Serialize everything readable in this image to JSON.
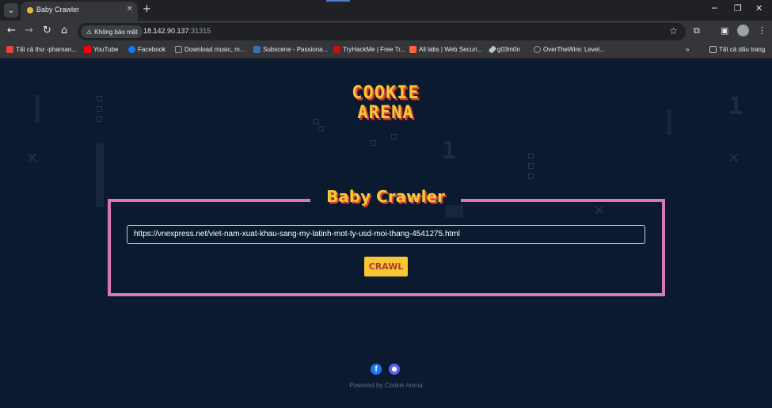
{
  "browser": {
    "tab_title": "Baby Crawler",
    "tab_favicon": "cookie-icon",
    "new_tab": "+",
    "security_chip": "Không bảo mật",
    "url_host": "18.142.90.137",
    "url_port": ":31315",
    "window_controls": {
      "minimize": "─",
      "maximize": "❐",
      "close": "✕"
    },
    "bookmarks": [
      {
        "label": "Tất cả thư -phaman...",
        "icon": "gmail-icon",
        "color": "#ea4335"
      },
      {
        "label": "YouTube",
        "icon": "youtube-icon",
        "color": "#ff0000"
      },
      {
        "label": "Facebook",
        "icon": "facebook-icon",
        "color": "#1877f2"
      },
      {
        "label": "Download music, m...",
        "icon": "download-icon",
        "color": "#9aa0a6"
      },
      {
        "label": "Subscene - Passiona...",
        "icon": "subscene-icon",
        "color": "#3d6db5"
      },
      {
        "label": "TryHackMe | Free Tr...",
        "icon": "tryhackme-icon",
        "color": "#c11111"
      },
      {
        "label": "All labs | Web Securi...",
        "icon": "portswigger-icon",
        "color": "#ff6633"
      },
      {
        "label": "g03m0n",
        "icon": "pen-icon",
        "color": "#bdc1c6"
      },
      {
        "label": "OverTheWire: Level...",
        "icon": "overthewire-icon",
        "color": "#9aa0a6"
      }
    ],
    "bookmarks_more": "»",
    "all_bookmarks": "Tất cả dấu trang"
  },
  "page": {
    "logo_line1": "COOKIE",
    "logo_line2": "ARENA",
    "panel_title": "Baby Crawler",
    "url_value": "https://vnexpress.net/viet-nam-xuat-khau-sang-my-latinh-mot-ty-usd-moi-thang-4541275.html",
    "crawl_label": "CRAWL",
    "footer_text": "Powered by Cookie Arena"
  },
  "colors": {
    "accent_yellow": "#f7c833",
    "accent_red": "#d9453a",
    "panel_border": "#d67ab9",
    "background": "#0b1a2e"
  }
}
